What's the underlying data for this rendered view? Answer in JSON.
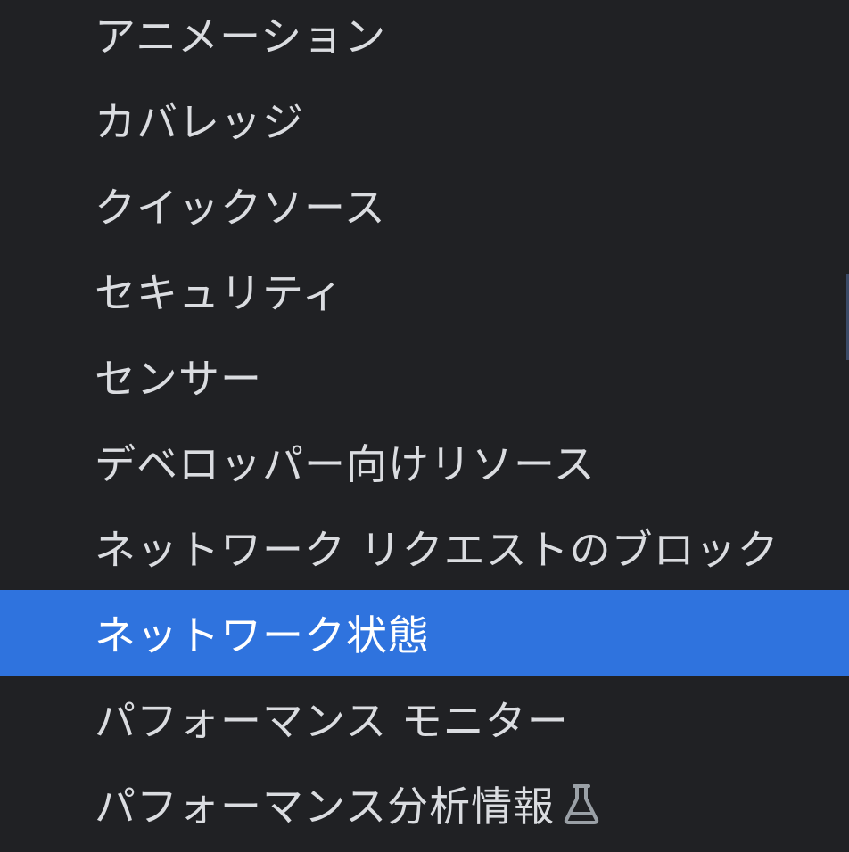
{
  "menu": {
    "items": [
      {
        "label": "アニメーション",
        "selected": false
      },
      {
        "label": "カバレッジ",
        "selected": false
      },
      {
        "label": "クイックソース",
        "selected": false
      },
      {
        "label": "セキュリティ",
        "selected": false
      },
      {
        "label": "センサー",
        "selected": false
      },
      {
        "label": "デベロッパー向けリソース",
        "selected": false
      },
      {
        "label": "ネットワーク リクエストのブロック",
        "selected": false
      },
      {
        "label": "ネットワーク状態",
        "selected": true
      },
      {
        "label": "パフォーマンス モニター",
        "selected": false
      },
      {
        "label": "パフォーマンス分析情報",
        "selected": false,
        "icon": "flask-icon"
      }
    ]
  },
  "colors": {
    "background": "#202124",
    "text": "#dadce0",
    "selected_background": "#2f73de",
    "selected_text": "#ffffff",
    "icon": "#9aa0a6"
  }
}
